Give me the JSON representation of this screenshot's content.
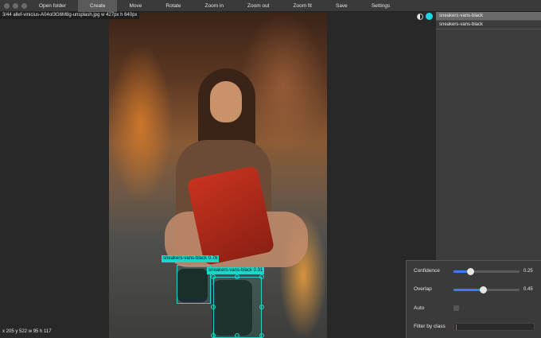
{
  "toolbar": {
    "items": [
      "Open folder",
      "Create",
      "Move",
      "Rotate",
      "Zoom in",
      "Zoom out",
      "Zoom fit",
      "Save",
      "Settings"
    ],
    "active": "Create"
  },
  "image": {
    "title": "3/44 allef-vinicius-A04oI3G6M8g-unsplash.jpg w 427px h 640px",
    "cursor": "x 205 y 522 w 95 h 117"
  },
  "annotations": [
    {
      "label": "sneakers-vans-black 0.76"
    },
    {
      "label": "sneakers-vans-black 0.91"
    }
  ],
  "classes": [
    "sneakers-vans-black",
    "sneakers-vans-black"
  ],
  "settings": {
    "confidence_label": "Confidence",
    "confidence_value": "0.25",
    "confidence": 0.25,
    "overlap_label": "Overlap",
    "overlap_value": "0.45",
    "overlap": 0.45,
    "auto_label": "Auto",
    "auto": false,
    "filter_label": "Filter by class",
    "filter_value": ""
  },
  "colors": {
    "box": "#1ed6c8",
    "accent": "#3d7bf0",
    "class_dot": "#1ed6e6"
  }
}
